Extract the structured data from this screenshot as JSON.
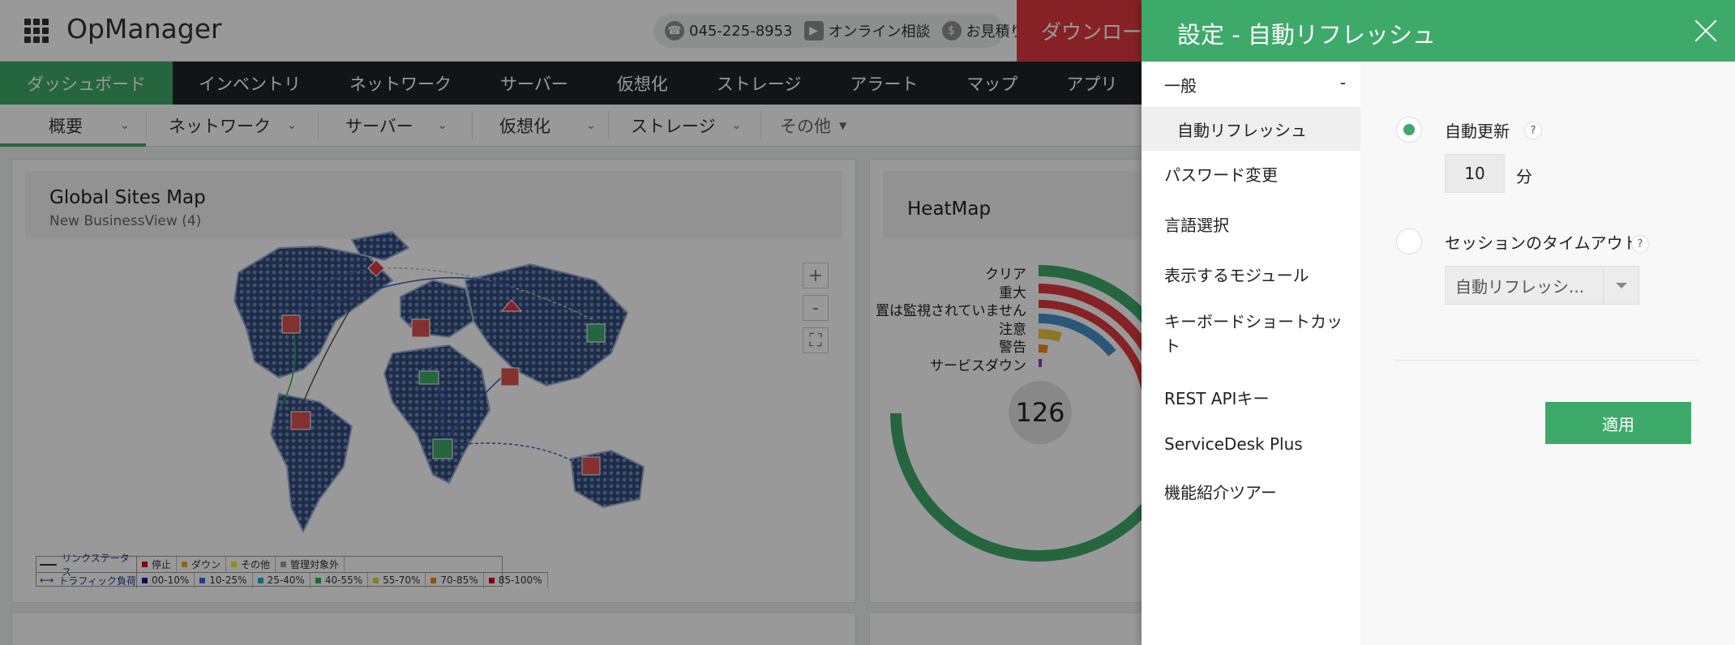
{
  "header": {
    "app_name": "OpManager",
    "phone": "045-225-8953",
    "online_consult": "オンライン相談",
    "estimate": "お見積り",
    "download_label": "ダウンロード"
  },
  "main_nav": [
    "ダッシュボード",
    "インベントリ",
    "ネットワーク",
    "サーバー",
    "仮想化",
    "ストレージ",
    "アラート",
    "マップ",
    "アプリ"
  ],
  "sub_nav": {
    "items": [
      "概要",
      "ネットワーク",
      "サーバー",
      "仮想化",
      "ストレージ"
    ],
    "more": "その他"
  },
  "sites_map": {
    "title": "Global Sites Map",
    "subtitle": "New BusinessView (4)",
    "zoom_in": "+",
    "zoom_out": "-",
    "legend": {
      "link_status": "リンクステータス",
      "traffic": "トラフィック負荷",
      "status_items": [
        {
          "label": "停止",
          "color": "#d0021b"
        },
        {
          "label": "ダウン",
          "color": "#f5a623"
        },
        {
          "label": "その他",
          "color": "#f8e71c"
        },
        {
          "label": "管理対象外",
          "color": "#9b9b9b"
        }
      ],
      "traffic_items": [
        {
          "label": "00-10%",
          "color": "#0b1f8c"
        },
        {
          "label": "10-25%",
          "color": "#2f6dd6"
        },
        {
          "label": "25-40%",
          "color": "#29a8df"
        },
        {
          "label": "40-55%",
          "color": "#25b54a"
        },
        {
          "label": "55-70%",
          "color": "#e6d22c"
        },
        {
          "label": "70-85%",
          "color": "#f08a1c"
        },
        {
          "label": "85-100%",
          "color": "#d0021b"
        }
      ]
    }
  },
  "heatmap": {
    "title": "HeatMap",
    "labels": [
      "クリア",
      "重大",
      "置は監視されていません",
      "注意",
      "警告",
      "サービスダウン"
    ],
    "count": "126"
  },
  "panel": {
    "title": "設定 - 自動リフレッシュ",
    "menu": {
      "section": "一般",
      "section_toggle": "-",
      "selected": "自動リフレッシュ",
      "items": [
        "パスワード変更",
        "言語選択",
        "表示するモジュール",
        "キーボードショートカット",
        "REST APIキー",
        "ServiceDesk Plus",
        "機能紹介ツアー"
      ]
    },
    "auto_update_label": "自動更新",
    "help": "?",
    "interval_value": "10",
    "interval_unit": "分",
    "session_timeout_label": "セッションのタイムアウト",
    "session_select_value": "自動リフレッシ...",
    "apply_label": "適用"
  },
  "colors": {
    "accent_green": "#3eaa6a",
    "download_red": "#e0393e",
    "nav_dark": "#1f2428"
  }
}
